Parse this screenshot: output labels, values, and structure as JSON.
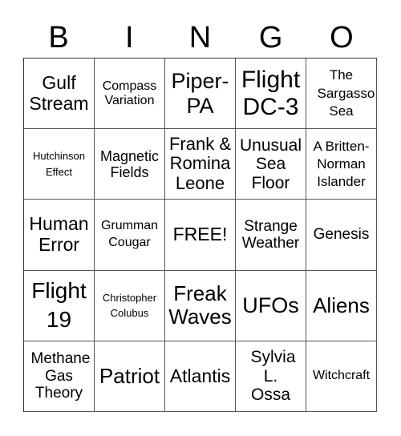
{
  "header": {
    "letters": [
      "B",
      "I",
      "N",
      "G",
      "O"
    ]
  },
  "cells": [
    [
      "Gulf Stream",
      "Compass Variation",
      "Piper-PA",
      "Flight DC-3",
      "The Sargasso Sea"
    ],
    [
      "Hutchinson Effect",
      "Magnetic Fields",
      "Frank & Romina Leone",
      "Unusual Sea Floor",
      "A Britten-Norman Islander"
    ],
    [
      "Human Error",
      "Grumman Cougar",
      "FREE!",
      "Strange Weather",
      "Genesis"
    ],
    [
      "Flight 19",
      "Christopher Colubus",
      "Freak Waves",
      "UFOs",
      "Aliens"
    ],
    [
      "Methane Gas Theory",
      "Patriot",
      "Atlantis",
      "Sylvia L. Ossa",
      "Witchcraft"
    ]
  ]
}
